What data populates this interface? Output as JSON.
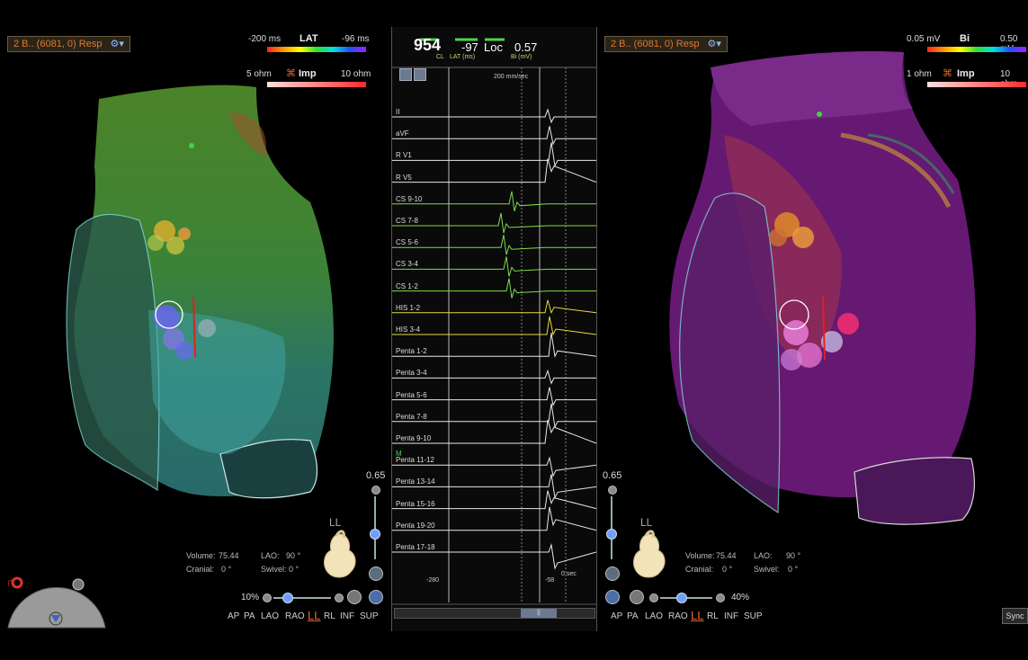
{
  "left_map": {
    "title": "2 B.. (6081, 0) Resp",
    "lat_scale": {
      "min": "-200 ms",
      "title": "LAT",
      "max": "-96 ms"
    },
    "imp_scale": {
      "min": "5 ohm",
      "title": "Imp",
      "max": "10 ohm"
    },
    "opacity": "0.65",
    "orientation_label": "LL",
    "volume_label": "Volume:",
    "volume_value": "75.44",
    "lao_label": "LAO:",
    "lao_value": "90 °",
    "cranial_label": "Cranial:",
    "cranial_value": "0 °",
    "swivel_label": "Swivel:",
    "swivel_value": "0 °",
    "zoom": "10%",
    "views": [
      "AP",
      "PA",
      "LAO",
      "RAO",
      "LL",
      "RL",
      "INF",
      "SUP"
    ],
    "active_view": "LL"
  },
  "right_map": {
    "title": "2 B.. (6081, 0) Resp",
    "bi_scale": {
      "min": "0.05 mV",
      "title": "Bi",
      "max": "0.50 mV"
    },
    "imp_scale": {
      "min": "1 ohm",
      "title": "Imp",
      "max": "10 ohm"
    },
    "opacity": "0.65",
    "orientation_label": "LL",
    "volume_label": "Volume:",
    "volume_value": "75.44",
    "lao_label": "LAO:",
    "lao_value": "90 °",
    "cranial_label": "Cranial:",
    "cranial_value": "0 °",
    "swivel_label": "Swivel:",
    "swivel_value": "0 °",
    "zoom": "40%",
    "views": [
      "AP",
      "PA",
      "LAO",
      "RAO",
      "LL",
      "RL",
      "INF",
      "SUP"
    ],
    "active_view": "LL",
    "sync_label": "Sync"
  },
  "ecg": {
    "cl_value": "954",
    "cl_label": "CL",
    "lat_value": "-97",
    "lat_label": "LAT (ms)",
    "loc_label": "Loc",
    "bi_value": "0.57",
    "bi_label": "Bi (mV)",
    "sweep_speed": "200 mm/sec",
    "marker_left": "-280",
    "marker_right": "-58",
    "marker_zero": "0 sec",
    "m_label": "M",
    "channels": [
      "II",
      "aVF",
      "R V1",
      "R V5",
      "CS 9-10",
      "CS 7-8",
      "CS 5-6",
      "CS 3-4",
      "CS 1-2",
      "HIS 1-2",
      "HIS 3-4",
      "Penta 1-2",
      "Penta 3-4",
      "Penta 5-6",
      "Penta 7-8",
      "Penta 9-10",
      "Penta 11-12",
      "Penta 13-14",
      "Penta 15-16",
      "Penta 19-20",
      "Penta 17-18"
    ],
    "channel_colors": [
      "#e8e8e8",
      "#e8e8e8",
      "#e8e8e8",
      "#e8e8e8",
      "#7ddc4a",
      "#7ddc4a",
      "#7ddc4a",
      "#7ddc4a",
      "#7ddc4a",
      "#e6dc3a",
      "#e6dc3a",
      "#e8e8e8",
      "#e8e8e8",
      "#e8e8e8",
      "#e8e8e8",
      "#e8e8e8",
      "#e8e8e8",
      "#e8e8e8",
      "#e8e8e8",
      "#e8e8e8",
      "#e8e8e8"
    ],
    "scroll_thumb_label": "||"
  }
}
